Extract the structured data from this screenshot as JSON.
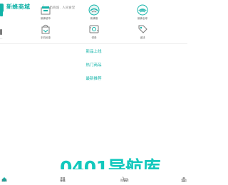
{
  "header": {
    "brand": "新蜂商城",
    "slogan": "山奶商城 . 人间食堂"
  },
  "row1": [
    {
      "label": "新蜂超市",
      "icon": "supermarket-icon"
    },
    {
      "label": "新蜂服",
      "icon": "clothing-icon"
    },
    {
      "label": "新蜂全球",
      "icon": "globe-icon"
    }
  ],
  "row2": [
    {
      "label": "手机优惠",
      "icon": "shopping-bag-icon"
    },
    {
      "label": "领券",
      "icon": "coupon-icon"
    },
    {
      "label": "省钱",
      "icon": "price-tag-icon"
    }
  ],
  "edge_left_label": "…",
  "links": {
    "new_products": "新品上线",
    "hot_products": "热门商品",
    "recommended": "最新推荐"
  },
  "watermark": "0401导航库",
  "tabbar": {
    "home": "首页",
    "category": "分类",
    "cart": "购物车",
    "mine": "我的"
  },
  "colors": {
    "accent": "#12b3a8",
    "watermark": "#12c8bd"
  }
}
